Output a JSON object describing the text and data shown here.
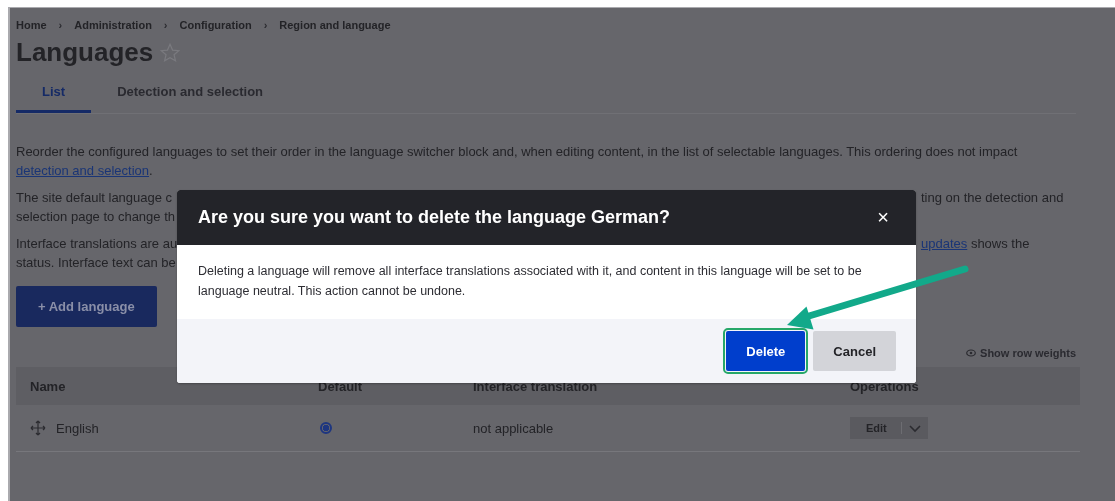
{
  "breadcrumb": {
    "separator": "›",
    "items": [
      {
        "label": "Home"
      },
      {
        "label": "Administration"
      },
      {
        "label": "Configuration"
      },
      {
        "label": "Region and language"
      }
    ]
  },
  "page_title": "Languages",
  "tabs": [
    {
      "label": "List",
      "selected": true
    },
    {
      "label": "Detection and selection",
      "selected": false
    }
  ],
  "intro": {
    "text": "Reorder the configured languages to set their order in the language switcher block and, when editing content, in the list of selectable languages. This ordering does not impact",
    "link": "detection and selection",
    "after": "."
  },
  "covered_paragraphs": [
    {
      "left_lines": [
        "The site default language c",
        "selection page to change th"
      ],
      "right_lines": [
        {
          "text": "ting on the detection and"
        }
      ]
    },
    {
      "left_lines": [
        "Interface translations are au",
        "status. Interface text can be"
      ],
      "right_lines": [
        {
          "link": "updates",
          "text": " shows the"
        }
      ]
    }
  ],
  "add_button": "+ Add language",
  "show_weights": "Show row weights",
  "table": {
    "columns": [
      "Name",
      "Default",
      "Interface translation",
      "Operations"
    ],
    "rows": [
      {
        "name": "English",
        "default": true,
        "translation": "not applicable",
        "operation": "Edit"
      }
    ]
  },
  "dialog": {
    "title": "Are you sure you want to delete the language German?",
    "close": "×",
    "message": "Deleting a language will remove all interface translations associated with it, and content in this language will be set to be language neutral. This action cannot be undone.",
    "buttons": [
      {
        "label": "Delete",
        "kind": "primary",
        "focused": true
      },
      {
        "label": "Cancel",
        "kind": "secondary",
        "focused": false
      }
    ]
  }
}
